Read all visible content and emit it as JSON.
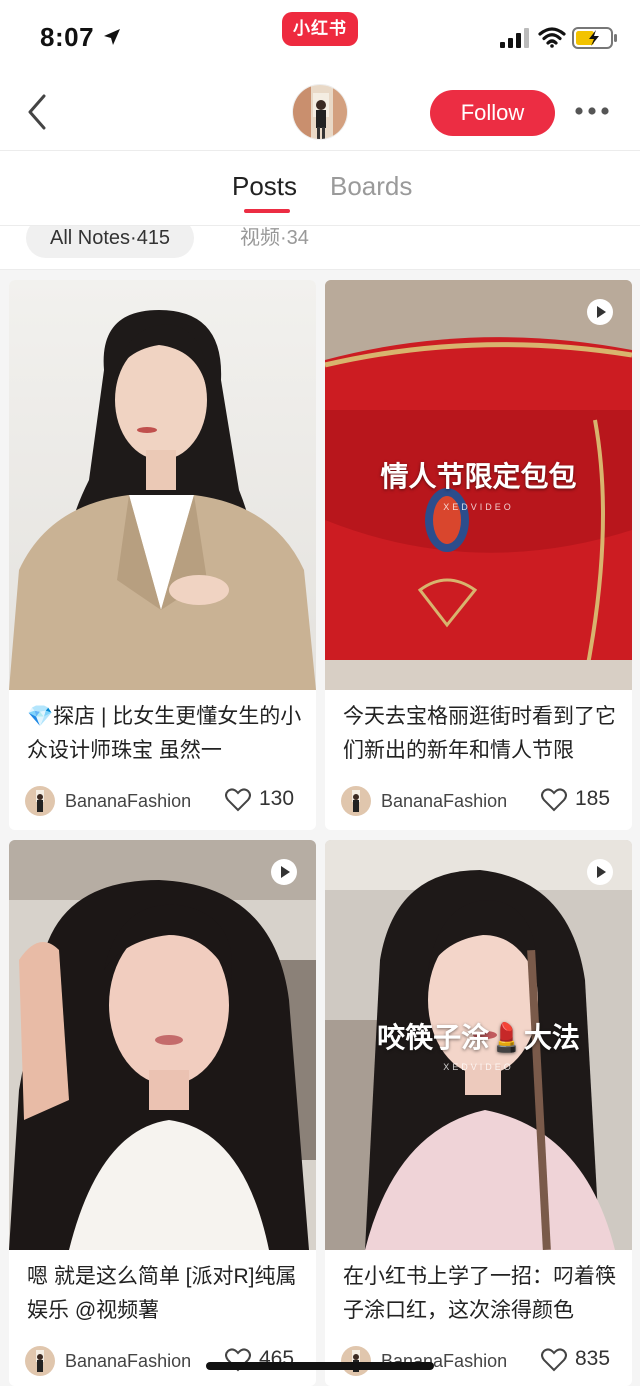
{
  "status": {
    "time": "8:07"
  },
  "brand": {
    "logo_text": "小红书",
    "color": "#ee2a3f"
  },
  "header": {
    "follow_label": "Follow",
    "accent": "#ec2d43"
  },
  "tabs": [
    {
      "label": "Posts",
      "active": true
    },
    {
      "label": "Boards",
      "active": false
    }
  ],
  "filters": {
    "all_notes": "All Notes·415",
    "videos": "视频·34"
  },
  "posts": [
    {
      "title": "💎探店 | 比女生更懂女生的小众设计师珠宝 虽然一",
      "user": "BananaFashion",
      "likes": "130",
      "is_video": false,
      "overlay": ""
    },
    {
      "title": "今天去宝格丽逛街时看到了它们新出的新年和情人节限",
      "user": "BananaFashion",
      "likes": "185",
      "is_video": true,
      "overlay": "情人节限定包包",
      "watermark": "XEDVIDEO"
    },
    {
      "title": "嗯 就是这么简单 [派对R]纯属娱乐 @视频薯",
      "user": "BananaFashion",
      "likes": "465",
      "is_video": true,
      "overlay": ""
    },
    {
      "title": "在小红书上学了一招：叼着筷子涂口红，这次涂得颜色",
      "user": "BananaFashion",
      "likes": "835",
      "is_video": true,
      "overlay": "咬筷子涂💄大法",
      "watermark": "XEDVIDEO"
    }
  ]
}
